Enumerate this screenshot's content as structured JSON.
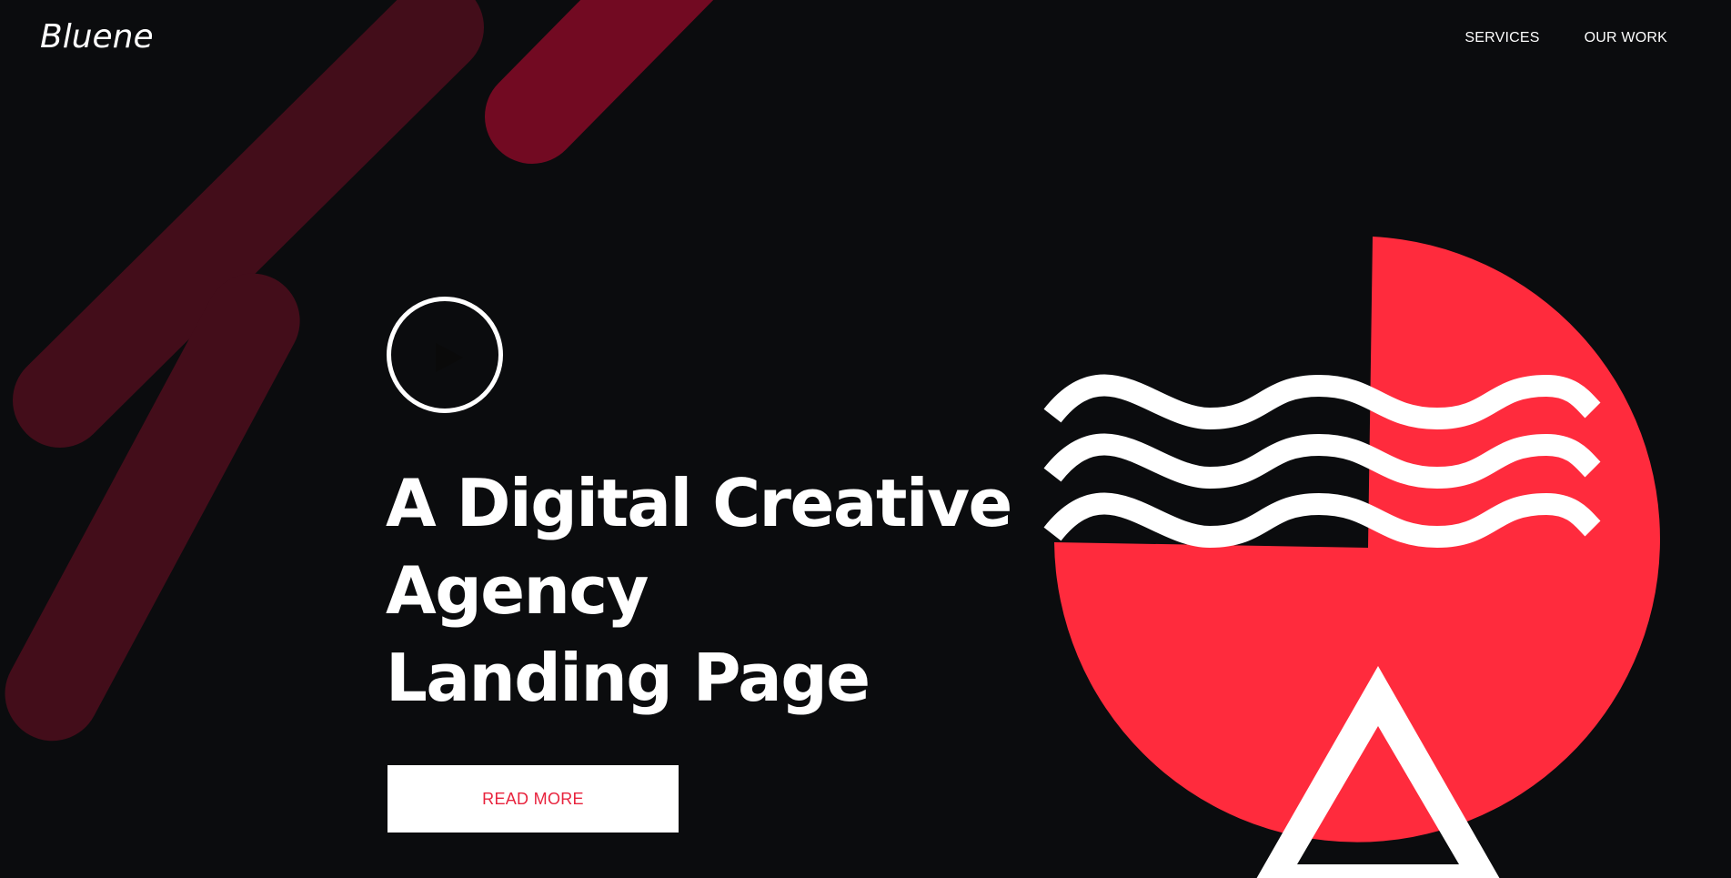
{
  "brand": {
    "name": "Bluene"
  },
  "nav": {
    "items": [
      {
        "label": "SERVICES"
      },
      {
        "label": "OUR WORK"
      }
    ]
  },
  "hero": {
    "play_icon": "play-icon",
    "headline_lines": [
      "A Digital Creative",
      "Agency",
      "Landing Page"
    ],
    "cta_label": "READ MORE"
  },
  "colors": {
    "background": "#0b0c0e",
    "accent": "#ff2b3d",
    "deco_dark": "#430d1a",
    "deco_mid": "#720a22",
    "text": "#ffffff",
    "cta_text": "#e8233d"
  }
}
